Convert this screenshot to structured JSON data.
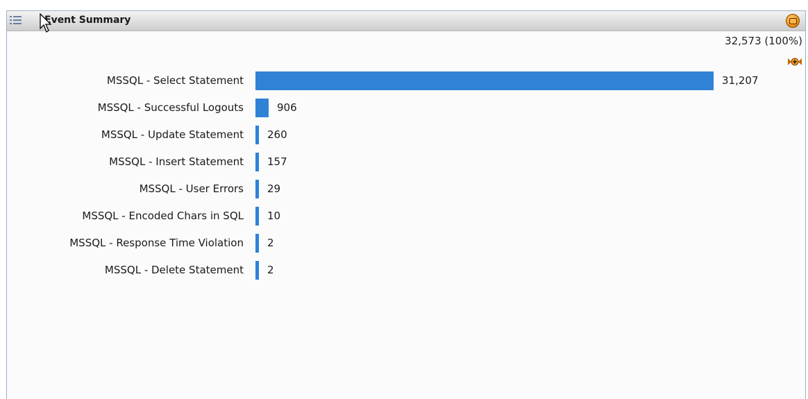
{
  "panel": {
    "title": "Event Summary",
    "total_label": "32,573 (100%)"
  },
  "icons": {
    "menu": "list-menu-icon",
    "close": "close-icon",
    "nav": "expand-arrows-icon",
    "cursor": "mouse-cursor-icon"
  },
  "colors": {
    "bar": "#2f82d6",
    "close_button": "#f39a1c"
  },
  "chart_data": {
    "type": "bar",
    "orientation": "horizontal",
    "categories": [
      "MSSQL - Select Statement",
      "MSSQL - Successful Logouts",
      "MSSQL - Update Statement",
      "MSSQL - Insert Statement",
      "MSSQL - User Errors",
      "MSSQL - Encoded Chars in SQL",
      "MSSQL - Response Time Violation",
      "MSSQL - Delete Statement"
    ],
    "values": [
      31207,
      906,
      260,
      157,
      29,
      10,
      2,
      2
    ],
    "value_labels": [
      "31,207",
      "906",
      "260",
      "157",
      "29",
      "10",
      "2",
      "2"
    ]
  }
}
